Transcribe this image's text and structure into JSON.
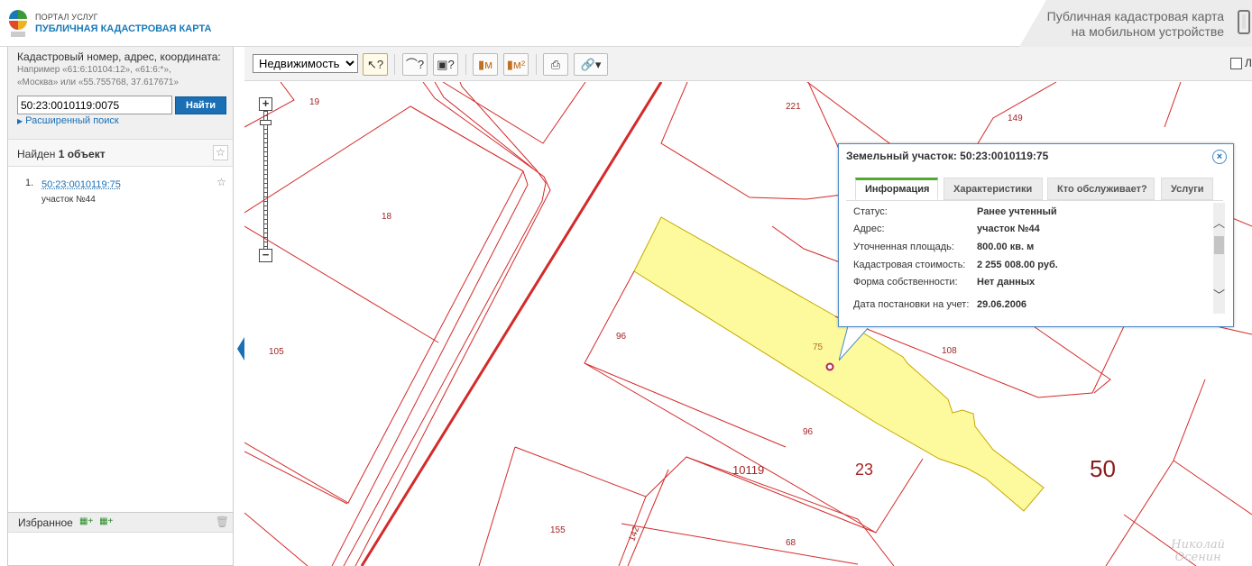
{
  "header": {
    "brand_top": "ПОРТАЛ УСЛУГ",
    "brand_bottom": "ПУБЛИЧНАЯ КАДАСТРОВАЯ КАРТА",
    "mobile_line1": "Публичная кадастровая карта",
    "mobile_line2": "на мобильном устройстве"
  },
  "search": {
    "title": "Кадастровый номер, адрес, координата:",
    "example_line1": "Например «61:6:10104:12», «61:6:*»,",
    "example_line2": "«Москва» или «55.755768, 37.617671»",
    "value": "50:23:0010119:0075",
    "button": "Найти",
    "advanced": "Расширенный поиск"
  },
  "results": {
    "header_prefix": "Найден ",
    "header_count": "1 объект",
    "items": [
      {
        "num": "1.",
        "link": "50:23:0010119:75",
        "sub": "участок №44"
      }
    ]
  },
  "favorites": {
    "label": "Избранное"
  },
  "toolbar": {
    "layer_select": "Недвижимость",
    "layer_options": [
      "Недвижимость"
    ],
    "checkbox_label": "Л"
  },
  "map_labels": [
    {
      "text": "19"
    },
    {
      "text": "221"
    },
    {
      "text": "149"
    },
    {
      "text": "18"
    },
    {
      "text": "105"
    },
    {
      "text": "96"
    },
    {
      "text": "75"
    },
    {
      "text": "108"
    },
    {
      "text": "96"
    },
    {
      "text": "10119"
    },
    {
      "text": "23"
    },
    {
      "text": "50"
    },
    {
      "text": "155"
    },
    {
      "text": "142"
    },
    {
      "text": "68"
    }
  ],
  "popup": {
    "title": "Земельный участок: 50:23:0010119:75",
    "tabs": [
      "Информация",
      "Характеристики",
      "Кто обслуживает?",
      "Услуги"
    ],
    "props": [
      {
        "label": "Статус:",
        "value": "Ранее учтенный"
      },
      {
        "label": "Адрес:",
        "value": "участок №44"
      },
      {
        "label": "Уточненная площадь:",
        "value": "800.00 кв. м"
      },
      {
        "label": "Кадастровая стоимость:",
        "value": "2 255 008.00 руб."
      },
      {
        "label": "Форма собственности:",
        "value": "Нет данных"
      },
      {
        "label": "Дата постановки на учет:",
        "value": "29.06.2006"
      }
    ]
  },
  "watermark": {
    "line1": "Николай",
    "line2": "Осенин"
  },
  "colors": {
    "parcel_line": "#d42a2a",
    "parcel_fill": "#fcfa9c",
    "accent": "#1a6fb5",
    "tab_active": "#52a832"
  }
}
